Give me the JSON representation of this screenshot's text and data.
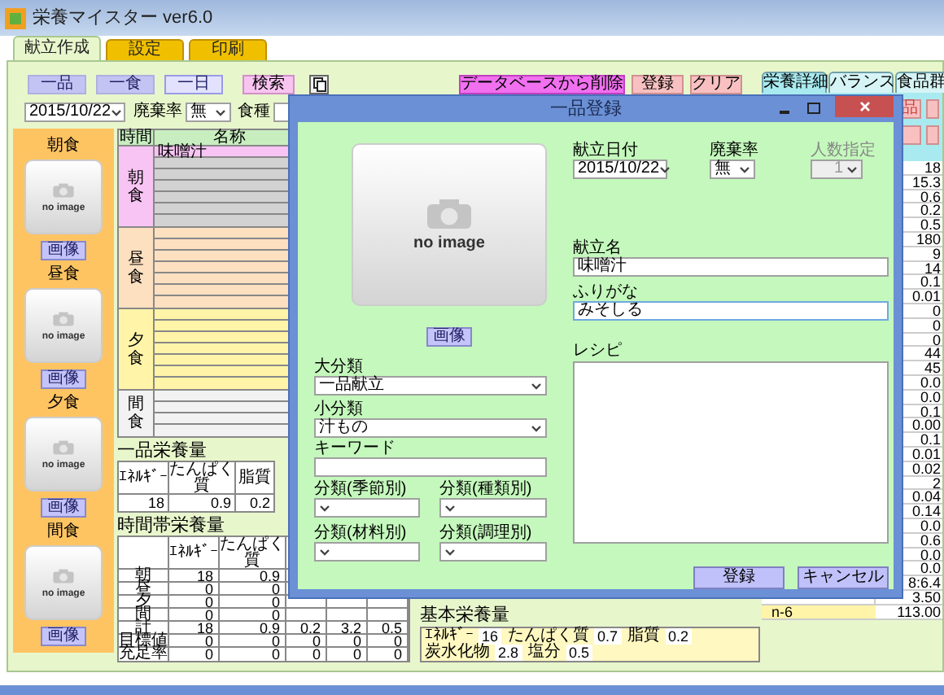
{
  "window": {
    "title": "栄養マイスター ver6.0"
  },
  "tabs": [
    {
      "label": "献立作成",
      "selected": true
    },
    {
      "label": "設定",
      "selected": false
    },
    {
      "label": "印刷",
      "selected": false
    }
  ],
  "toolbar": {
    "modes": [
      {
        "label": "一品",
        "selected": false
      },
      {
        "label": "一食",
        "selected": false
      },
      {
        "label": "一日",
        "selected": true
      }
    ],
    "search": "検索",
    "actions": [
      {
        "label": "データベースから削除",
        "kind": "delete"
      },
      {
        "label": "登録",
        "kind": "normal"
      },
      {
        "label": "クリア",
        "kind": "normal"
      }
    ]
  },
  "filters": {
    "date": "2015/10/22",
    "waste_label": "廃棄率",
    "waste": "無",
    "meal_type_label": "食種"
  },
  "meals": [
    {
      "label": "朝食",
      "image": "no image",
      "button": "画像"
    },
    {
      "label": "昼食",
      "image": "no image",
      "button": "画像"
    },
    {
      "label": "夕食",
      "image": "no image",
      "button": "画像"
    },
    {
      "label": "間食",
      "image": "no image",
      "button": "画像"
    }
  ],
  "menu_table": {
    "columns": [
      "時間",
      "名称"
    ],
    "sections": [
      {
        "label": "朝食",
        "kind": "breakfast",
        "items": [
          "味噌汁"
        ]
      },
      {
        "label": "昼食",
        "kind": "lunch"
      },
      {
        "label": "夕食",
        "kind": "dinner"
      },
      {
        "label": "間食",
        "kind": "snack"
      }
    ]
  },
  "item_nutrition": {
    "title": "一品栄養量",
    "columns": [
      "ｴﾈﾙｷﾞｰ",
      "たんぱく質",
      "脂質"
    ],
    "values": [
      "18",
      "0.9",
      "0.2"
    ]
  },
  "time_nutrition": {
    "title": "時間帯栄養量",
    "columns": [
      "ｴﾈﾙｷﾞｰ",
      "たんぱく質"
    ],
    "rows": [
      {
        "label": "朝",
        "values": [
          "18",
          "0.9"
        ]
      },
      {
        "label": "昼",
        "values": [
          "0",
          "0"
        ]
      },
      {
        "label": "夕",
        "values": [
          "0",
          "0"
        ]
      },
      {
        "label": "間",
        "values": [
          "0",
          "0"
        ]
      },
      {
        "label": "計",
        "values": [
          "18",
          "0.9",
          "0.2",
          "3.2",
          "0.5"
        ]
      },
      {
        "label": "目標値",
        "values": [
          "0",
          "0",
          "0",
          "0",
          "0"
        ]
      },
      {
        "label": "充足率",
        "values": [
          "0",
          "0",
          "0",
          "0",
          "0"
        ]
      }
    ]
  },
  "basic_nutrition": {
    "title": "基本栄養量",
    "items": [
      {
        "label": "ｴﾈﾙｷﾞｰ",
        "value": "16"
      },
      {
        "label": "たんぱく質",
        "value": "0.7"
      },
      {
        "label": "脂質",
        "value": "0.2"
      },
      {
        "label": "炭水化物",
        "value": "2.8"
      },
      {
        "label": "塩分",
        "value": "0.5"
      }
    ]
  },
  "side_panel": {
    "tabs": [
      {
        "label": "栄養詳細",
        "selected": true
      },
      {
        "label": "バランス",
        "selected": false
      },
      {
        "label": "食品群",
        "selected": false
      }
    ],
    "button": "品",
    "rows": [
      {
        "value": "18"
      },
      {
        "value": "15.3"
      },
      {
        "value": "0.6"
      },
      {
        "value": "0.2"
      },
      {
        "value": "0.5"
      },
      {
        "value": "180"
      },
      {
        "value": "9"
      },
      {
        "value": "14"
      },
      {
        "value": "0.1"
      },
      {
        "value": "0.01"
      },
      {
        "value": "0"
      },
      {
        "value": "0"
      },
      {
        "value": "0"
      },
      {
        "value": "44"
      },
      {
        "value": "45"
      },
      {
        "value": "0.0"
      },
      {
        "value": "0.0"
      },
      {
        "value": "0.1"
      },
      {
        "value": "0.00"
      },
      {
        "value": "0.1"
      },
      {
        "value": "0.01"
      },
      {
        "value": "0.02"
      },
      {
        "value": "2"
      },
      {
        "value": "0.04"
      },
      {
        "value": "0.14"
      },
      {
        "value": "0.0"
      },
      {
        "value": "0.6"
      },
      {
        "value": "0.0"
      },
      {
        "value": "0.0"
      },
      {
        "value": "8:6.4"
      },
      {
        "value": "3.50"
      },
      {
        "label": "n-6",
        "value": "113.00"
      }
    ]
  },
  "dialog": {
    "title": "一品登録",
    "image": "no image",
    "image_button": "画像",
    "major_category": {
      "label": "大分類",
      "value": "一品献立"
    },
    "minor_category": {
      "label": "小分類",
      "value": "汁もの"
    },
    "keyword": {
      "label": "キーワード"
    },
    "classifications": [
      {
        "label": "分類(季節別)"
      },
      {
        "label": "分類(種類別)"
      },
      {
        "label": "分類(材料別)"
      },
      {
        "label": "分類(調理別)"
      }
    ],
    "date": {
      "label": "献立日付",
      "value": "2015/10/22"
    },
    "waste": {
      "label": "廃棄率",
      "value": "無"
    },
    "headcount": {
      "label": "人数指定",
      "value": "1",
      "disabled": true
    },
    "menu_name": {
      "label": "献立名",
      "value": "味噌汁"
    },
    "reading": {
      "label": "ふりがな",
      "value": "みそしる"
    },
    "recipe": {
      "label": "レシピ"
    },
    "buttons": [
      {
        "label": "登録"
      },
      {
        "label": "キャンセル"
      }
    ]
  }
}
